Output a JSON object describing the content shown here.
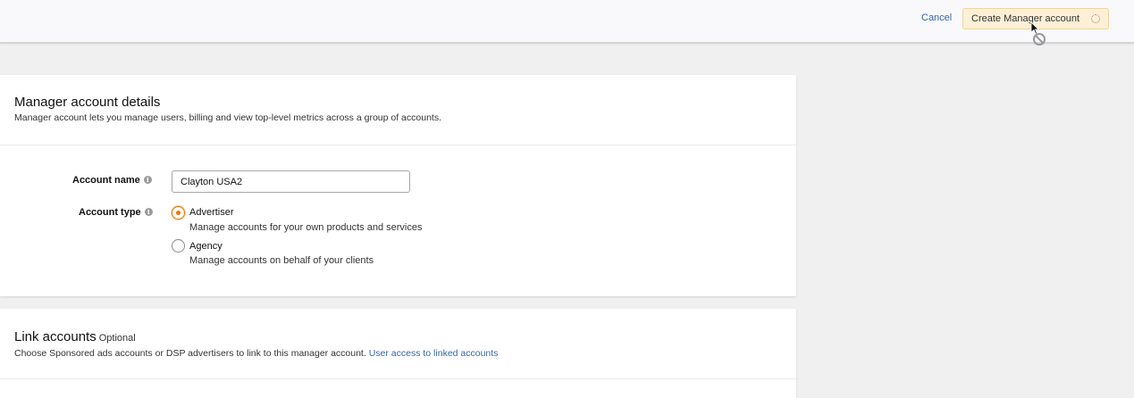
{
  "header": {
    "cancel_label": "Cancel",
    "create_label": "Create Manager account"
  },
  "details": {
    "title": "Manager account details",
    "description": "Manager account lets you manage users, billing and view top-level metrics across a group of accounts.",
    "account_name_label": "Account name",
    "account_name_value": "Clayton USA2",
    "account_type_label": "Account type",
    "options": [
      {
        "label": "Advertiser",
        "description": "Manage accounts for your own products and services",
        "selected": true
      },
      {
        "label": "Agency",
        "description": "Manage accounts on behalf of your clients",
        "selected": false
      }
    ]
  },
  "link_accounts": {
    "title": "Link accounts",
    "optional": "Optional",
    "description": "Choose Sponsored ads accounts or DSP advertisers to link to this manager account.",
    "link_text": "User access to linked accounts"
  },
  "icons": {
    "info": "info-icon",
    "spinner": "loading-spinner-icon",
    "cursor": "mouse-cursor-icon"
  },
  "colors": {
    "accent": "#e77600",
    "link": "#3367a8",
    "button_bg": "#fdf0d6"
  }
}
